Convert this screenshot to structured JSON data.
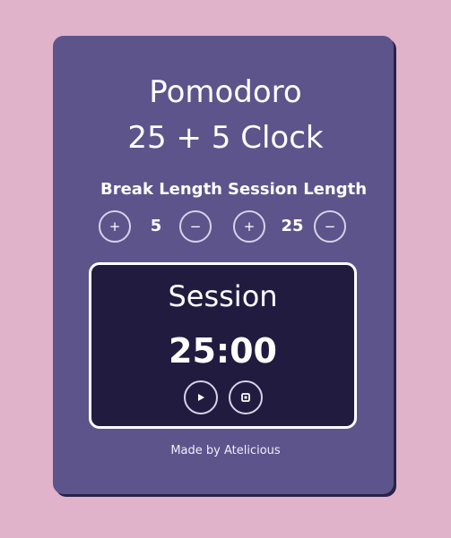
{
  "app": {
    "title_line1": "Pomodoro",
    "title_line2": "25 + 5 Clock"
  },
  "break": {
    "label": "Break Length",
    "value": "5",
    "increment_label": "+",
    "decrement_label": "−"
  },
  "session": {
    "label": "Session Length",
    "value": "25",
    "increment_label": "+",
    "decrement_label": "−"
  },
  "timer": {
    "label": "Session",
    "time_left": "25:00",
    "play_icon": "play-icon",
    "reset_icon": "reset-icon"
  },
  "footer": {
    "credit": "Made by Atelicious"
  },
  "colors": {
    "page_background": "#e0b3cb",
    "card": "#5d548c",
    "timer_panel": "#221b40",
    "text": "#ffffff"
  }
}
